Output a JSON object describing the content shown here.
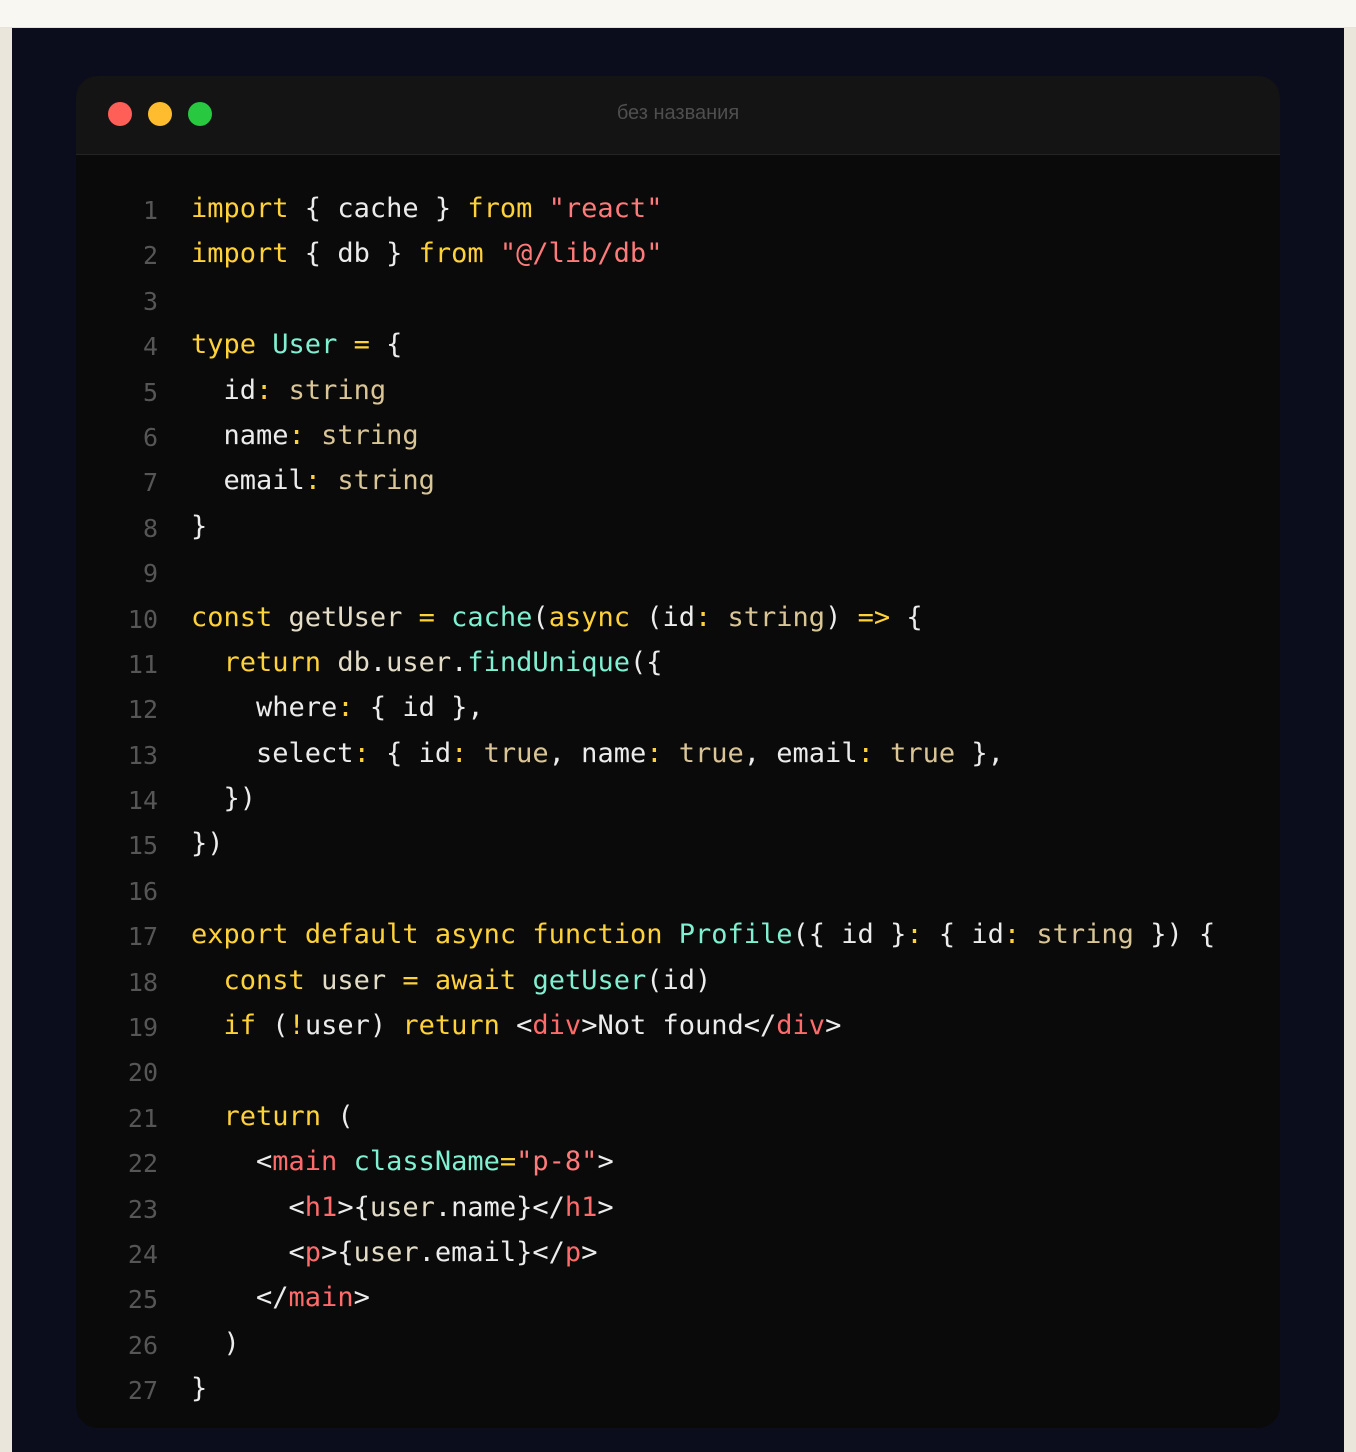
{
  "window": {
    "title": "без названия",
    "colors": {
      "close": "#ff5f57",
      "minimize": "#febc2e",
      "zoom": "#28c840"
    }
  },
  "palette": {
    "keyword": "#ffd23a",
    "type": "#d9c596",
    "function": "#7ff0d0",
    "string": "#ff7a7a",
    "tag": "#ff6b6b",
    "plain": "#ececec",
    "line_number": "#565656"
  },
  "code": [
    {
      "n": "1",
      "tokens": [
        [
          "kw",
          "import"
        ],
        [
          "pl",
          " { cache } "
        ],
        [
          "kw",
          "from"
        ],
        [
          "pl",
          " "
        ],
        [
          "str",
          "\"react\""
        ]
      ]
    },
    {
      "n": "2",
      "tokens": [
        [
          "kw",
          "import"
        ],
        [
          "pl",
          " { db } "
        ],
        [
          "kw",
          "from"
        ],
        [
          "pl",
          " "
        ],
        [
          "str",
          "\"@/lib/db\""
        ]
      ]
    },
    {
      "n": "3",
      "tokens": []
    },
    {
      "n": "4",
      "tokens": [
        [
          "kw",
          "type"
        ],
        [
          "pl",
          " "
        ],
        [
          "fn",
          "User"
        ],
        [
          "pl",
          " "
        ],
        [
          "kw",
          "="
        ],
        [
          "pl",
          " {"
        ]
      ]
    },
    {
      "n": "5",
      "tokens": [
        [
          "pl",
          "  id"
        ],
        [
          "kw",
          ":"
        ],
        [
          "pl",
          " "
        ],
        [
          "ty",
          "string"
        ]
      ]
    },
    {
      "n": "6",
      "tokens": [
        [
          "pl",
          "  name"
        ],
        [
          "kw",
          ":"
        ],
        [
          "pl",
          " "
        ],
        [
          "ty",
          "string"
        ]
      ]
    },
    {
      "n": "7",
      "tokens": [
        [
          "pl",
          "  email"
        ],
        [
          "kw",
          ":"
        ],
        [
          "pl",
          " "
        ],
        [
          "ty",
          "string"
        ]
      ]
    },
    {
      "n": "8",
      "tokens": [
        [
          "pl",
          "}"
        ]
      ]
    },
    {
      "n": "9",
      "tokens": []
    },
    {
      "n": "10",
      "tokens": [
        [
          "kw",
          "const"
        ],
        [
          "pl",
          " "
        ],
        [
          "id",
          "getUser"
        ],
        [
          "pl",
          " "
        ],
        [
          "kw",
          "="
        ],
        [
          "pl",
          " "
        ],
        [
          "fn",
          "cache"
        ],
        [
          "pl",
          "("
        ],
        [
          "kw",
          "async"
        ],
        [
          "pl",
          " (id"
        ],
        [
          "kw",
          ":"
        ],
        [
          "pl",
          " "
        ],
        [
          "ty",
          "string"
        ],
        [
          "pl",
          ") "
        ],
        [
          "kw",
          "=>"
        ],
        [
          "pl",
          " {"
        ]
      ]
    },
    {
      "n": "11",
      "tokens": [
        [
          "pl",
          "  "
        ],
        [
          "kw",
          "return"
        ],
        [
          "pl",
          " "
        ],
        [
          "id",
          "db"
        ],
        [
          "pl",
          "."
        ],
        [
          "id",
          "user"
        ],
        [
          "pl",
          "."
        ],
        [
          "fn",
          "findUnique"
        ],
        [
          "pl",
          "({"
        ]
      ]
    },
    {
      "n": "12",
      "tokens": [
        [
          "pl",
          "    where"
        ],
        [
          "kw",
          ":"
        ],
        [
          "pl",
          " { id },"
        ]
      ]
    },
    {
      "n": "13",
      "tokens": [
        [
          "pl",
          "    select"
        ],
        [
          "kw",
          ":"
        ],
        [
          "pl",
          " { id"
        ],
        [
          "kw",
          ":"
        ],
        [
          "pl",
          " "
        ],
        [
          "ty",
          "true"
        ],
        [
          "pl",
          ", name"
        ],
        [
          "kw",
          ":"
        ],
        [
          "pl",
          " "
        ],
        [
          "ty",
          "true"
        ],
        [
          "pl",
          ", email"
        ],
        [
          "kw",
          ":"
        ],
        [
          "pl",
          " "
        ],
        [
          "ty",
          "true"
        ],
        [
          "pl",
          " },"
        ]
      ]
    },
    {
      "n": "14",
      "tokens": [
        [
          "pl",
          "  })"
        ]
      ]
    },
    {
      "n": "15",
      "tokens": [
        [
          "pl",
          "})"
        ]
      ]
    },
    {
      "n": "16",
      "tokens": []
    },
    {
      "n": "17",
      "tokens": [
        [
          "kw",
          "export"
        ],
        [
          "pl",
          " "
        ],
        [
          "kw",
          "default"
        ],
        [
          "pl",
          " "
        ],
        [
          "kw",
          "async"
        ],
        [
          "pl",
          " "
        ],
        [
          "kw",
          "function"
        ],
        [
          "pl",
          " "
        ],
        [
          "fn",
          "Profile"
        ],
        [
          "pl",
          "({ id }"
        ],
        [
          "kw",
          ":"
        ],
        [
          "pl",
          " { id"
        ],
        [
          "kw",
          ":"
        ],
        [
          "pl",
          " "
        ],
        [
          "ty",
          "string"
        ],
        [
          "pl",
          " }) {"
        ]
      ]
    },
    {
      "n": "18",
      "tokens": [
        [
          "pl",
          "  "
        ],
        [
          "kw",
          "const"
        ],
        [
          "pl",
          " "
        ],
        [
          "id",
          "user"
        ],
        [
          "pl",
          " "
        ],
        [
          "kw",
          "="
        ],
        [
          "pl",
          " "
        ],
        [
          "kw",
          "await"
        ],
        [
          "pl",
          " "
        ],
        [
          "fn",
          "getUser"
        ],
        [
          "pl",
          "(id)"
        ]
      ]
    },
    {
      "n": "19",
      "tokens": [
        [
          "pl",
          "  "
        ],
        [
          "kw",
          "if"
        ],
        [
          "pl",
          " ("
        ],
        [
          "kw",
          "!"
        ],
        [
          "pl",
          "user) "
        ],
        [
          "kw",
          "return"
        ],
        [
          "pl",
          " <"
        ],
        [
          "tag",
          "div"
        ],
        [
          "pl",
          ">Not found</"
        ],
        [
          "tag",
          "div"
        ],
        [
          "pl",
          ">"
        ]
      ]
    },
    {
      "n": "20",
      "tokens": []
    },
    {
      "n": "21",
      "tokens": [
        [
          "pl",
          "  "
        ],
        [
          "kw",
          "return"
        ],
        [
          "pl",
          " ("
        ]
      ]
    },
    {
      "n": "22",
      "tokens": [
        [
          "pl",
          "    <"
        ],
        [
          "tag",
          "main"
        ],
        [
          "pl",
          " "
        ],
        [
          "fn",
          "className"
        ],
        [
          "kw",
          "="
        ],
        [
          "str",
          "\"p-8\""
        ],
        [
          "pl",
          ">"
        ]
      ]
    },
    {
      "n": "23",
      "tokens": [
        [
          "pl",
          "      <"
        ],
        [
          "tag",
          "h1"
        ],
        [
          "pl",
          ">{"
        ],
        [
          "id",
          "user"
        ],
        [
          "pl",
          ".name}</"
        ],
        [
          "tag",
          "h1"
        ],
        [
          "pl",
          ">"
        ]
      ]
    },
    {
      "n": "24",
      "tokens": [
        [
          "pl",
          "      <"
        ],
        [
          "tag",
          "p"
        ],
        [
          "pl",
          ">{"
        ],
        [
          "id",
          "user"
        ],
        [
          "pl",
          ".email}</"
        ],
        [
          "tag",
          "p"
        ],
        [
          "pl",
          ">"
        ]
      ]
    },
    {
      "n": "25",
      "tokens": [
        [
          "pl",
          "    </"
        ],
        [
          "tag",
          "main"
        ],
        [
          "pl",
          ">"
        ]
      ]
    },
    {
      "n": "26",
      "tokens": [
        [
          "pl",
          "  )"
        ]
      ]
    },
    {
      "n": "27",
      "tokens": [
        [
          "pl",
          "}"
        ]
      ]
    }
  ]
}
